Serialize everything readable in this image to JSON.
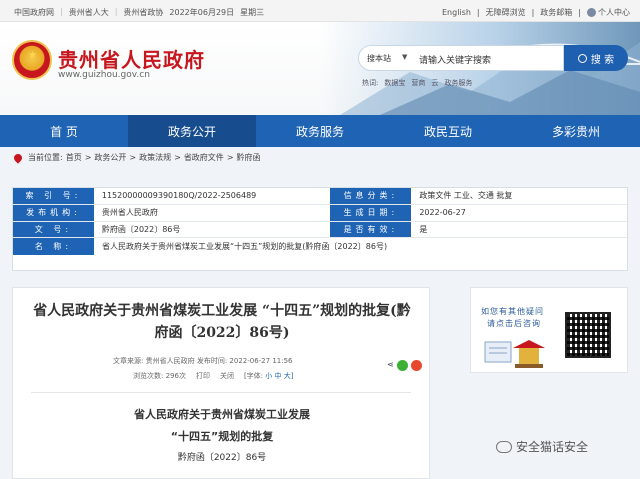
{
  "topbar": {
    "left_links": [
      "中国政府网",
      "贵州省人大",
      "贵州省政协"
    ],
    "date": "2022年06月29日",
    "weekday": "星期三",
    "right_links": [
      "English",
      "无障碍浏览",
      "政务邮箱"
    ],
    "user": "个人中心"
  },
  "header": {
    "title": "贵州省人民政府",
    "url": "www.guizhou.gov.cn"
  },
  "search": {
    "scope": "搜本站",
    "placeholder": "请输入关键字搜索",
    "button": "搜 索",
    "hot_label": "热词:",
    "hot_words": [
      "数据宝",
      "营商",
      "云",
      "政务服务"
    ]
  },
  "nav": {
    "items": [
      "首 页",
      "政务公开",
      "政务服务",
      "政民互动",
      "多彩贵州"
    ],
    "active_index": 1
  },
  "breadcrumb": {
    "label": "当前位置:",
    "items": [
      "首页",
      "政务公开",
      "政策法规",
      "省政府文件",
      "黔府函"
    ],
    "separator": ">"
  },
  "meta": {
    "index_label": "索 引 号:",
    "index_value": "11520000009390180Q/2022-2506489",
    "category_label": "信息分类:",
    "category_value": "政策文件  工业、交通  批复",
    "issuer_label": "发布机构:",
    "issuer_value": "贵州省人民政府",
    "date_label": "生成日期:",
    "date_value": "2022-06-27",
    "doc_label": "文 号:",
    "doc_value": "黔府函〔2022〕86号",
    "valid_label": "是否有效:",
    "valid_value": "是",
    "name_label": "名 称:",
    "name_value": "省人民政府关于贵州省煤炭工业发展“十四五”规划的批复(黔府函〔2022〕86号)"
  },
  "article": {
    "title": "省人民政府关于贵州省煤炭工业发展 “十四五”规划的批复(黔府函〔2022〕86号)",
    "source": "文章来源: 贵州省人民政府",
    "published": "发布时间: 2022-06-27 11:56",
    "views": "浏览次数: 296次",
    "print": "打印",
    "close": "关闭",
    "font_label": "[字体:",
    "font_small": "小",
    "font_mid": "中",
    "font_big": "大]",
    "share_icon": "share-icon",
    "body_title_1": "省人民政府关于贵州省煤炭工业发展",
    "body_title_2": "“十四五”规划的批复",
    "body_docno": "黔府函〔2022〕86号"
  },
  "sidebar": {
    "line1": "如您有其他疑问",
    "line2": "请点击后咨询"
  },
  "watermark": {
    "text": "安全猫话安全"
  },
  "colors": {
    "nav_blue": "#1f63b4",
    "title_red": "#c7161e"
  }
}
